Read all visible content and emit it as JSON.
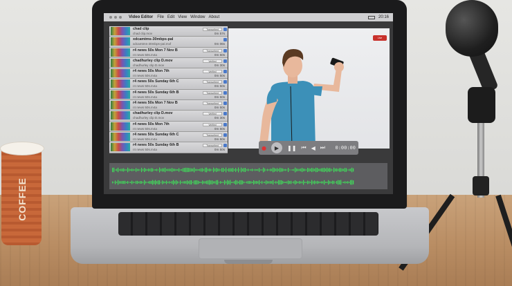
{
  "menubar": {
    "app_name": "Video Editor",
    "menus": [
      "File",
      "Edit",
      "View",
      "Window",
      "About"
    ],
    "clock": "20:16"
  },
  "clips": [
    {
      "name": "chad clip",
      "file": "chad clip.mov",
      "tag": "Transcribed",
      "duration": "0m 57s"
    },
    {
      "name": "xdcamtms-30mbps-pal",
      "file": "xdcamtms-30mbps-pal.mxf",
      "tag": "",
      "duration": "0m 06s"
    },
    {
      "name": "r4 news 50s Mon 7 Nov B",
      "file": "r4 news 50s.m4a",
      "tag": "Transcribed",
      "duration": "0m 50s"
    },
    {
      "name": "chadhurley clip D.mov",
      "file": "chadhurley clip D.mov",
      "tag": "Verified",
      "duration": "0m 30s"
    },
    {
      "name": "r4 news 50s Mon 7th",
      "file": "r4 news 50s.m4a",
      "tag": "Verified",
      "duration": "0m 50s"
    },
    {
      "name": "r4 news 50s Sunday 6th C",
      "file": "r4 news 50s.m4a",
      "tag": "Transcribed",
      "duration": "0m 50s"
    },
    {
      "name": "r4 news 50s Sunday 6th B",
      "file": "r4 news 50s.m4a",
      "tag": "Transcribed",
      "duration": "0m 50s"
    },
    {
      "name": "r4 news 50s Mon 7 Nov B",
      "file": "r4 news 50s.m4a",
      "tag": "Transcribed",
      "duration": "0m 50s"
    },
    {
      "name": "chadhurley clip D.mov",
      "file": "chadhurley clip D.mov",
      "tag": "Verified",
      "duration": "0m 30s"
    },
    {
      "name": "r4 news 50s Mon 7th",
      "file": "r4 news 50s.m4a",
      "tag": "Verified",
      "duration": "0m 50s"
    },
    {
      "name": "r4 news 50s Sunday 6th C",
      "file": "r4 news 50s.m4a",
      "tag": "Transcribed",
      "duration": "0m 50s"
    },
    {
      "name": "r4 news 50s Sunday 6th B",
      "file": "r4 news 50s.m4a",
      "tag": "Transcribed",
      "duration": "0m 50s"
    }
  ],
  "preview": {
    "badge": "Live"
  },
  "transport": {
    "time": "0:00:00"
  },
  "scene": {
    "cup_text": "COFFEE"
  },
  "colors": {
    "waveform": "#3fe05a",
    "record": "#c8312c",
    "shirt": "#3c90b8"
  }
}
